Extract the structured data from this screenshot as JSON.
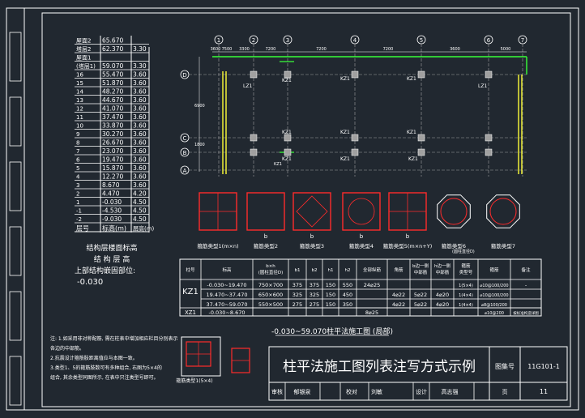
{
  "story_table": {
    "rows": [
      {
        "floor": "屋面2",
        "elev": "65.670",
        "h": ""
      },
      {
        "floor": "塔层2",
        "elev": "62.370",
        "h": "3.30"
      },
      {
        "floor": "屋面1",
        "elev": "",
        "h": ""
      },
      {
        "floor": "(塔层1)",
        "elev": "59.070",
        "h": "3.30"
      },
      {
        "floor": "16",
        "elev": "55.470",
        "h": "3.60"
      },
      {
        "floor": "15",
        "elev": "51.870",
        "h": "3.60"
      },
      {
        "floor": "14",
        "elev": "48.270",
        "h": "3.60"
      },
      {
        "floor": "13",
        "elev": "44.670",
        "h": "3.60"
      },
      {
        "floor": "12",
        "elev": "41.070",
        "h": "3.60"
      },
      {
        "floor": "11",
        "elev": "37.470",
        "h": "3.60"
      },
      {
        "floor": "10",
        "elev": "33.870",
        "h": "3.60"
      },
      {
        "floor": "9",
        "elev": "30.270",
        "h": "3.60"
      },
      {
        "floor": "8",
        "elev": "26.670",
        "h": "3.60"
      },
      {
        "floor": "7",
        "elev": "23.070",
        "h": "3.60"
      },
      {
        "floor": "6",
        "elev": "19.470",
        "h": "3.60"
      },
      {
        "floor": "5",
        "elev": "15.870",
        "h": "3.60"
      },
      {
        "floor": "4",
        "elev": "12.270",
        "h": "3.60"
      },
      {
        "floor": "3",
        "elev": "8.670",
        "h": "3.60"
      },
      {
        "floor": "2",
        "elev": "4.470",
        "h": "4.20"
      },
      {
        "floor": "1",
        "elev": "-0.030",
        "h": "4.50"
      },
      {
        "floor": "-1",
        "elev": "-4.530",
        "h": "4.50"
      },
      {
        "floor": "-2",
        "elev": "-9.030",
        "h": "4.50"
      }
    ],
    "header": {
      "floor": "层号",
      "elev": "标高(m)",
      "h": "层高(m)"
    },
    "caption1": "结构层楼面标高",
    "caption2": "结 构 层 高",
    "embed_label": "上部结构嵌固部位:",
    "embed_value": "-0.030"
  },
  "plan": {
    "axes_v": [
      "1",
      "2",
      "3",
      "4",
      "5",
      "6",
      "7"
    ],
    "axes_h": [
      "D",
      "C",
      "B",
      "A"
    ],
    "top_dims": [
      "3600",
      "7500",
      "3300",
      "7200",
      "7200",
      "7200",
      "3600",
      "5000"
    ],
    "left_dims": [
      "6900",
      "1800"
    ],
    "kz1": "KZ1",
    "lz1": "LZ1",
    "caption": "-0.030~59.070柱平法施工图 (局部)"
  },
  "sections": [
    {
      "top": "",
      "label": "箍筋类型1(m×n)"
    },
    {
      "top": "b",
      "label": "箍筋类型2"
    },
    {
      "top": "b",
      "label": "箍筋类型3"
    },
    {
      "top": "b",
      "label": "箍筋类型4"
    },
    {
      "top": "b",
      "label": "箍筋类型5(m×n+Y)"
    },
    {
      "top": "",
      "label": "箍筋类型6"
    },
    {
      "top": "",
      "label": "箍筋类型7"
    }
  ],
  "section_note": "(圆柱直径D)",
  "col_table": {
    "headers": [
      "柱号",
      "标高",
      "b×h\n(圆柱直径D)",
      "b1",
      "b2",
      "h1",
      "h2",
      "全部纵筋",
      "角筋",
      "b边一侧\n中部筋",
      "h边一侧\n中部筋",
      "箍筋\n类型号",
      "箍筋",
      "备注"
    ],
    "group_label": "KZ1",
    "rows": [
      [
        "-0.030~19.470",
        "750×700",
        "375",
        "375",
        "150",
        "550",
        "24⌀25",
        "",
        "",
        "",
        "1(5×4)",
        "⌀10@100/200",
        "-"
      ],
      [
        "19.470~37.470",
        "650×600",
        "325",
        "325",
        "150",
        "450",
        "",
        "4⌀22",
        "5⌀22",
        "4⌀20",
        "1(4×4)",
        "⌀10@100/200",
        ""
      ],
      [
        "37.470~59.070",
        "550×500",
        "275",
        "275",
        "150",
        "350",
        "",
        "4⌀22",
        "5⌀22",
        "4⌀20",
        "1(4×4)",
        "⌀8@100/200",
        ""
      ]
    ],
    "xz1": {
      "label": "XZ1",
      "elev": "-0.030~8.670",
      "bars": "8⌀25",
      "hoop": "按标准构造详图",
      "note": "⌀10@200"
    }
  },
  "notes": [
    "注: 1.如采用非对称配筋, 需在柱表中增加相应栏目分别表示",
    "    各边的中部筋。",
    "    2.抗震设计箍筋肢距离值应与本图一致。",
    "    3.类型1、5的箍筋肢数可有多种组合, 右图为5×4的",
    "    组合, 其余类型同图所示, 在表中只注类型号即可。"
  ],
  "small_section_label": "箍筋类型1(5×4)",
  "title_block": {
    "title": "柱平法施工图列表注写方式示例",
    "atlas_label": "图集号",
    "atlas_no": "11G101-1",
    "review_label": "审核",
    "reviewer": "郁银泉",
    "check_label": "校对",
    "checker": "刘敏",
    "design_label": "设计",
    "designer": "高志强",
    "page_label": "页",
    "page_no": "11"
  },
  "colors": {
    "background": "#212830",
    "line": "#ffffff",
    "red": "#ff2b2b",
    "green": "#39ff39",
    "yellow": "#ffff3a",
    "cyan": "#4de1ff",
    "grey": "#a0a0a0"
  }
}
